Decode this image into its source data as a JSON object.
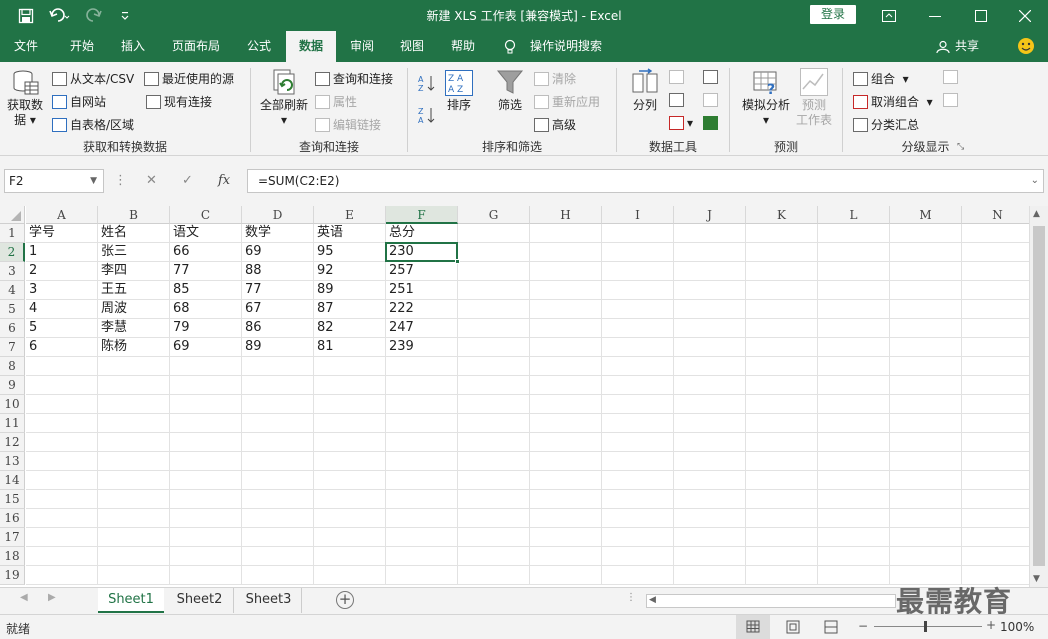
{
  "titlebar": {
    "title": "新建 XLS 工作表  [兼容模式]  -  Excel",
    "login_label": "登录",
    "bg": "#217346"
  },
  "tabs": [
    {
      "label": "文件"
    },
    {
      "label": "开始"
    },
    {
      "label": "插入"
    },
    {
      "label": "页面布局"
    },
    {
      "label": "公式"
    },
    {
      "label": "数据"
    },
    {
      "label": "审阅"
    },
    {
      "label": "视图"
    },
    {
      "label": "帮助"
    },
    {
      "label": "操作说明搜索"
    }
  ],
  "share_label": "共享",
  "ribbon": {
    "get_transform": {
      "get_data_1": "获取数",
      "get_data_2": "据",
      "from_text": "从文本/CSV",
      "from_web": "自网站",
      "from_table": "自表格/区域",
      "recent_sources": "最近使用的源",
      "existing_conn": "现有连接",
      "label": "获取和转换数据"
    },
    "queries": {
      "refresh_all": "全部刷新",
      "queries_conn": "查询和连接",
      "properties": "属性",
      "edit_links": "编辑链接",
      "label": "查询和连接"
    },
    "sort_filter": {
      "sort": "排序",
      "filter": "筛选",
      "clear": "清除",
      "reapply": "重新应用",
      "advanced": "高级",
      "label": "排序和筛选"
    },
    "data_tools": {
      "text_to_columns": "分列",
      "label": "数据工具"
    },
    "forecast": {
      "what_if": "模拟分析",
      "forecast_sheet_1": "预测",
      "forecast_sheet_2": "工作表",
      "label": "预测"
    },
    "outline": {
      "group": "组合",
      "ungroup": "取消组合",
      "subtotal": "分类汇总",
      "label": "分级显示"
    }
  },
  "formula_bar": {
    "name_box": "F2",
    "formula": "=SUM(C2:E2)",
    "fx": "fx"
  },
  "grid": {
    "columns": [
      "A",
      "B",
      "C",
      "D",
      "E",
      "F",
      "G",
      "H",
      "I",
      "J",
      "K",
      "L",
      "M",
      "N"
    ],
    "row_numbers": [
      "1",
      "2",
      "3",
      "4",
      "5",
      "6",
      "7",
      "8",
      "9",
      "10",
      "11",
      "12",
      "13",
      "14",
      "15",
      "16",
      "17",
      "18",
      "19"
    ],
    "rows": [
      [
        "学号",
        "姓名",
        "语文",
        "数学",
        "英语",
        "总分"
      ],
      [
        "1",
        "张三",
        "66",
        "69",
        "95",
        "230"
      ],
      [
        "2",
        "李四",
        "77",
        "88",
        "92",
        "257"
      ],
      [
        "3",
        "王五",
        "85",
        "77",
        "89",
        "251"
      ],
      [
        "4",
        "周波",
        "68",
        "67",
        "87",
        "222"
      ],
      [
        "5",
        "李慧",
        "79",
        "86",
        "82",
        "247"
      ],
      [
        "6",
        "陈杨",
        "69",
        "89",
        "81",
        "239"
      ]
    ],
    "selected_col": "F",
    "selected_row": "2"
  },
  "sheets": [
    {
      "label": "Sheet1",
      "active": true
    },
    {
      "label": "Sheet2",
      "active": false
    },
    {
      "label": "Sheet3",
      "active": false
    }
  ],
  "status": {
    "ready": "就绪",
    "zoom": "100%"
  },
  "watermark": "最需教育"
}
